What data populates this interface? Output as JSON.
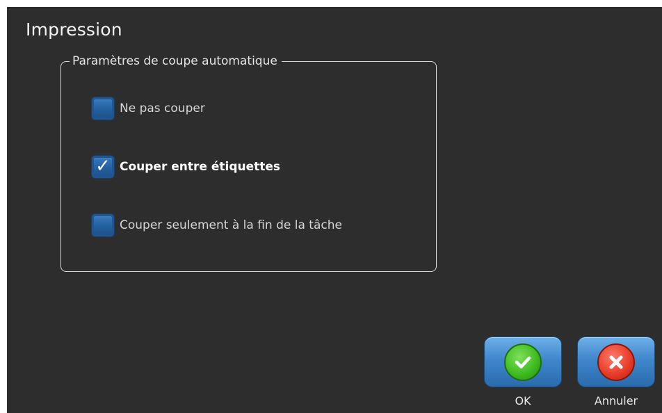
{
  "dialog": {
    "title": "Impression"
  },
  "cut_settings": {
    "legend": "Paramètres de coupe automatique",
    "options": [
      {
        "label": "Ne pas couper",
        "checked": false
      },
      {
        "label": "Couper entre étiquettes",
        "checked": true
      },
      {
        "label": "Couper seulement à la fin de la tâche",
        "checked": false
      }
    ]
  },
  "buttons": {
    "ok_label": "OK",
    "cancel_label": "Annuler"
  },
  "icons": {
    "checkbox_check": "checkmark-icon",
    "ok": "ok-check-icon",
    "cancel": "cancel-x-icon"
  },
  "colors": {
    "background": "#2d2d2d",
    "button": "#3f86cc",
    "ok_icon": "#3cb81f",
    "cancel_icon": "#e53a25"
  }
}
